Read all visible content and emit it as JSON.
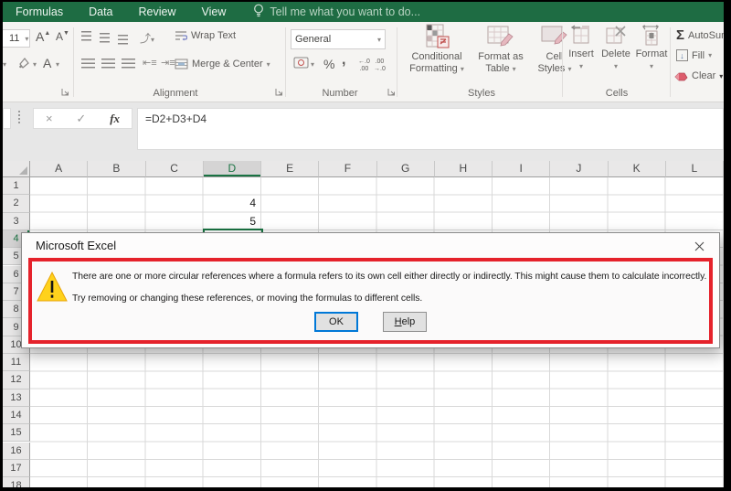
{
  "tab_bar": {
    "tabs": [
      {
        "label": "Formulas"
      },
      {
        "label": "Data"
      },
      {
        "label": "Review"
      },
      {
        "label": "View"
      }
    ],
    "tell_me": "Tell me what you want to do...",
    "color": "#1e6c43"
  },
  "ribbon": {
    "font_size_value": "11",
    "font_grow": "A",
    "font_shrink": "A",
    "font_color": "A",
    "alignment": {
      "wrap_text": "Wrap Text",
      "merge_center": "Merge & Center",
      "label": "Alignment"
    },
    "number": {
      "format_value": "General",
      "percent": "%",
      "comma": ",",
      "inc_top": "←.0",
      "inc_bottom": ".00",
      "dec_top": ".00",
      "dec_bottom": "→.0",
      "label": "Number"
    },
    "styles": {
      "buttons": [
        [
          "Conditional",
          "Formatting"
        ],
        [
          "Format as",
          "Table"
        ],
        [
          "Cell",
          "Styles"
        ]
      ],
      "label": "Styles"
    },
    "cells": {
      "buttons": [
        "Insert",
        "Delete",
        "Format"
      ],
      "label": "Cells"
    },
    "editing": {
      "sigma": "Σ",
      "autosum": "AutoSum",
      "fill": "Fill",
      "clear": "Clear"
    },
    "dropdown_glyph": "▾"
  },
  "formula_bar": {
    "cancel": "×",
    "enter": "✓",
    "fx": "fx",
    "formula": "=D2+D3+D4"
  },
  "grid": {
    "columns": [
      "A",
      "B",
      "C",
      "D",
      "E",
      "F",
      "G",
      "H",
      "I",
      "J",
      "K",
      "L"
    ],
    "rows": [
      "1",
      "2",
      "3",
      "4",
      "5",
      "6",
      "7",
      "8",
      "9",
      "10",
      "11",
      "12",
      "13",
      "14",
      "15",
      "16",
      "17",
      "18"
    ],
    "selected_column": "D",
    "selected_row": "4",
    "active_cell": "D4",
    "cells": [
      {
        "col": "D",
        "row": "2",
        "value": "4"
      },
      {
        "col": "D",
        "row": "3",
        "value": "5"
      }
    ],
    "selection_color": "#1a7343"
  },
  "dialog": {
    "title": "Microsoft Excel",
    "message_line1": "There are one or more circular references where a formula refers to its own cell either directly or indirectly. This might cause them to calculate incorrectly.",
    "message_line2": "Try removing or changing these references, or moving the formulas to different cells.",
    "buttons": {
      "ok": "OK",
      "help": "Help"
    },
    "annotation_color": "#e5222b",
    "warning_color": "#ffd21c"
  }
}
